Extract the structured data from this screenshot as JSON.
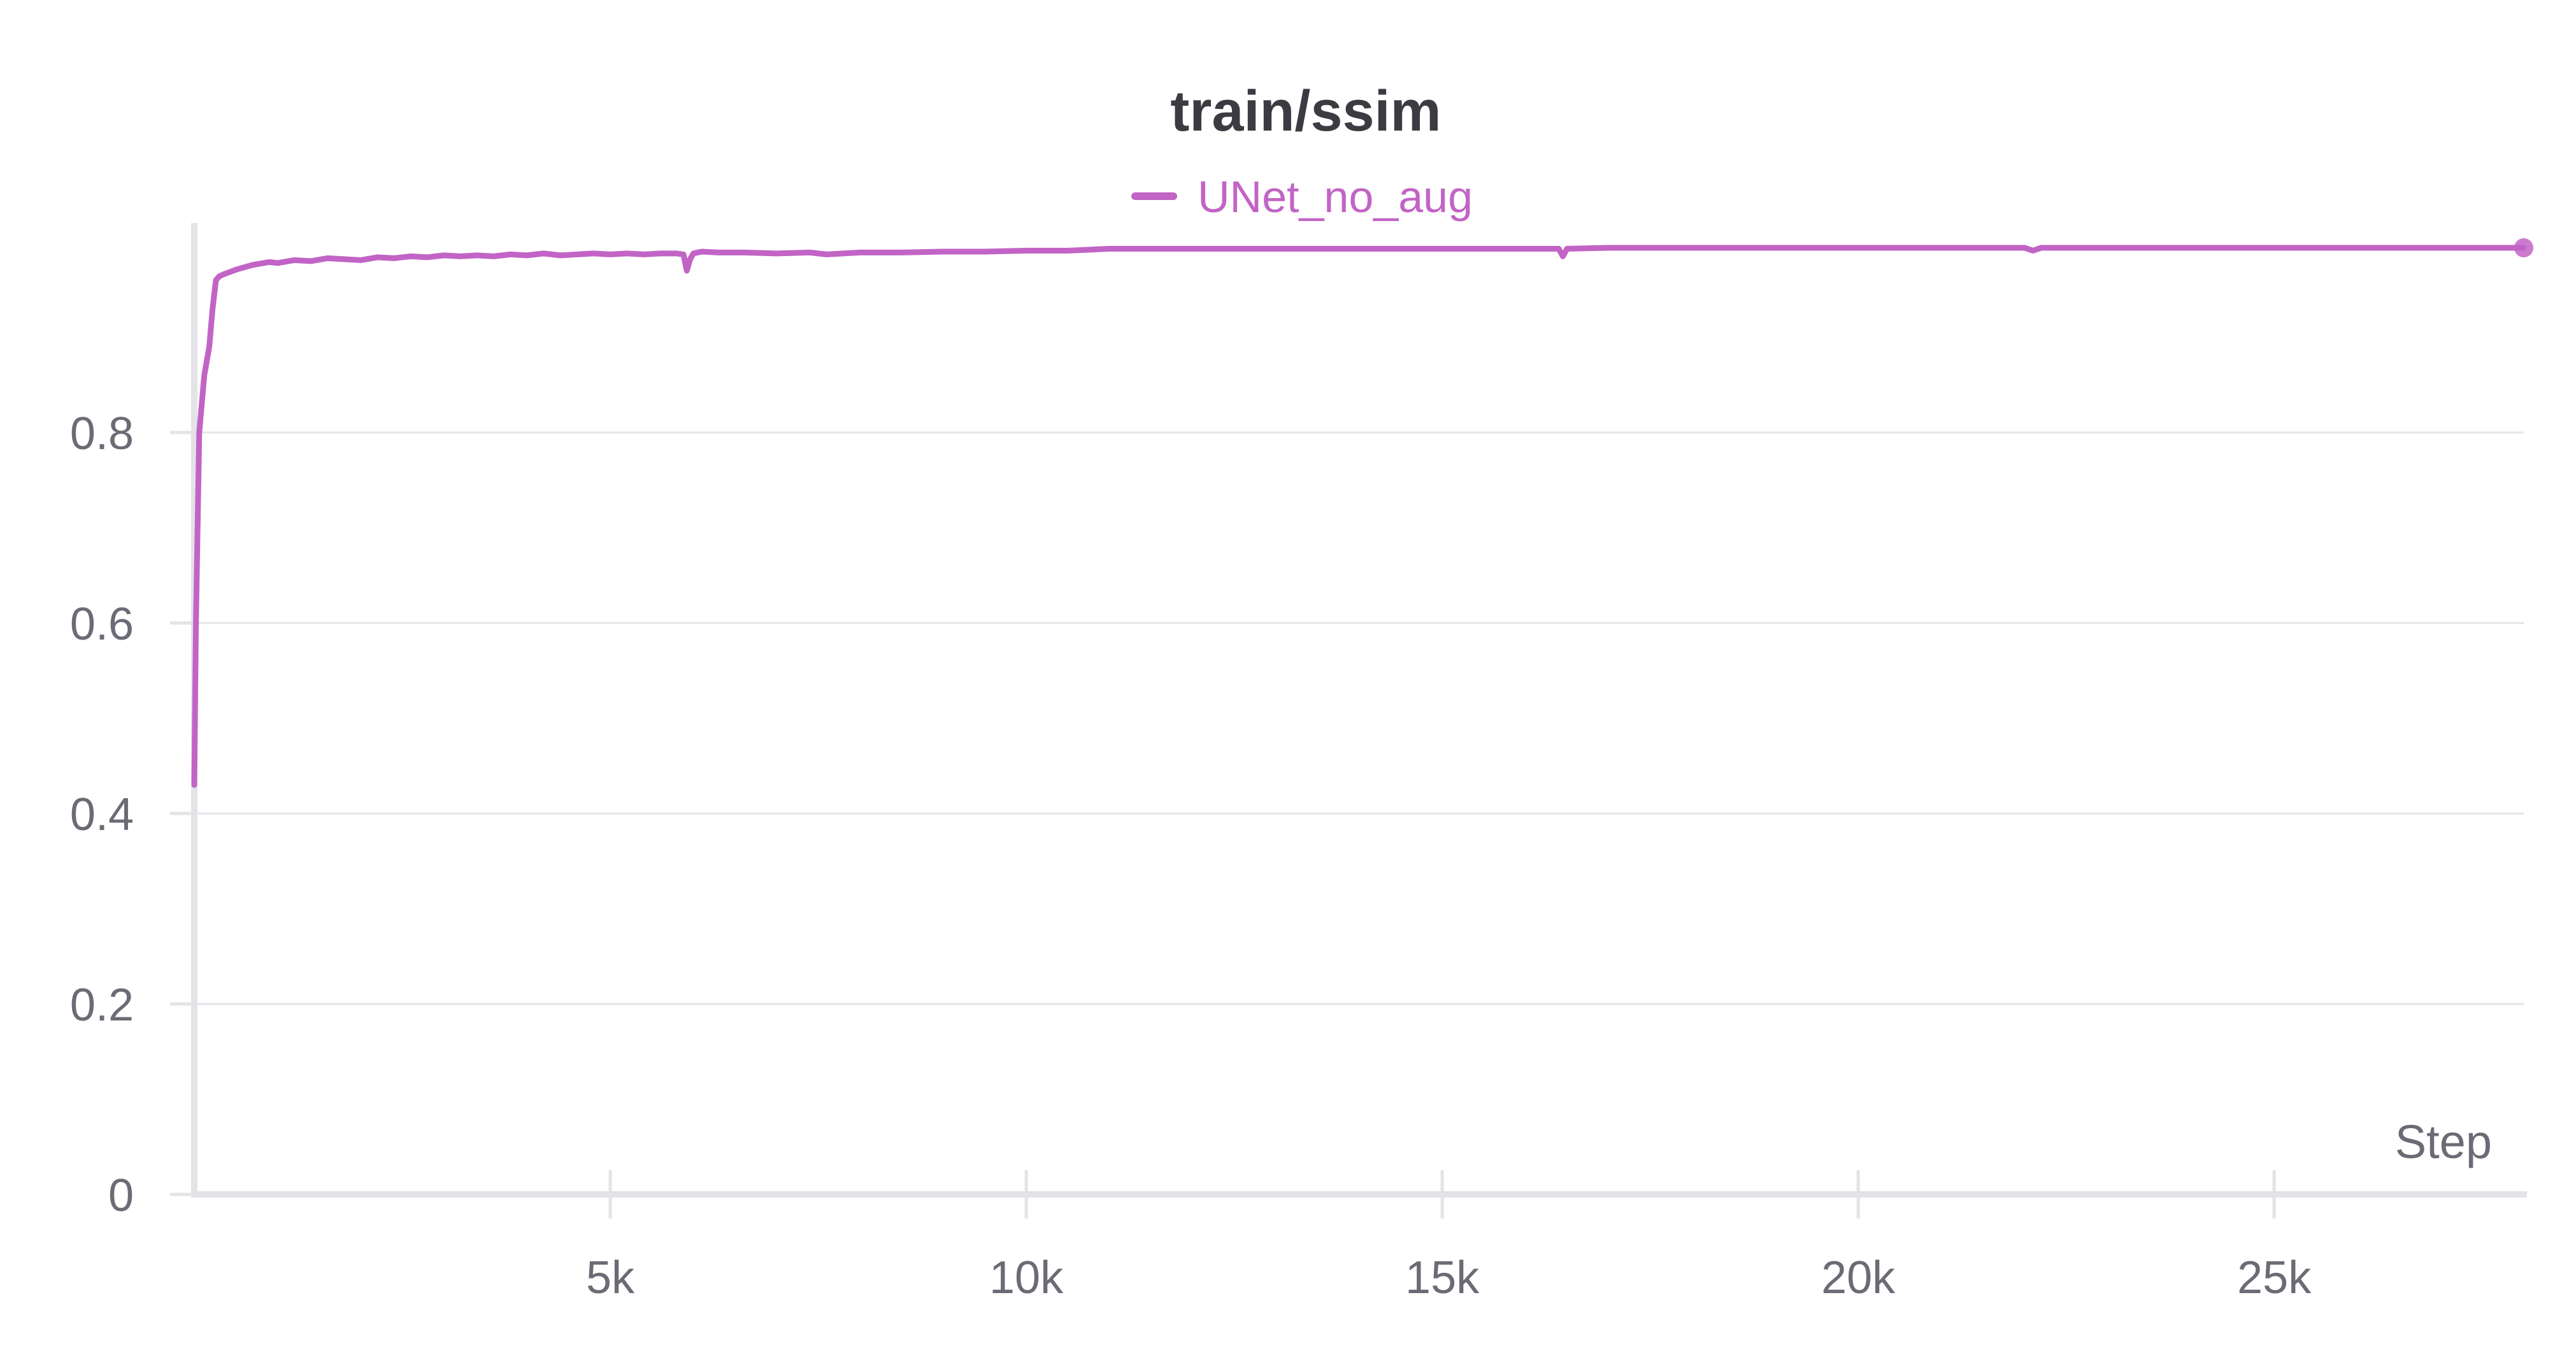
{
  "chart_data": {
    "type": "line",
    "title": "train/ssim",
    "xlabel": "Step",
    "ylabel": "",
    "xlim": [
      0,
      28000
    ],
    "ylim": [
      0,
      1
    ],
    "x_ticks": [
      5000,
      10000,
      15000,
      20000,
      25000
    ],
    "x_tick_labels": [
      "5k",
      "10k",
      "15k",
      "20k",
      "25k"
    ],
    "y_ticks": [
      0,
      0.2,
      0.4,
      0.6,
      0.8
    ],
    "y_tick_labels": [
      "0",
      "0.2",
      "0.4",
      "0.6",
      "0.8"
    ],
    "grid": true,
    "legend_position": "top-center",
    "series": [
      {
        "name": "UNet_no_aug",
        "color": "#c264c5",
        "x": [
          0,
          20,
          60,
          120,
          180,
          220,
          260,
          300,
          350,
          500,
          700,
          900,
          1000,
          1200,
          1400,
          1600,
          1800,
          2000,
          2200,
          2400,
          2600,
          2800,
          3000,
          3200,
          3400,
          3600,
          3800,
          4000,
          4200,
          4400,
          4600,
          4800,
          5000,
          5200,
          5400,
          5600,
          5800,
          5880,
          5920,
          5960,
          6000,
          6100,
          6300,
          6600,
          7000,
          7400,
          7600,
          7800,
          8000,
          8500,
          9000,
          9500,
          10000,
          10500,
          11000,
          12000,
          13000,
          14000,
          15000,
          16000,
          16400,
          16450,
          16500,
          17000,
          18000,
          19000,
          20000,
          21000,
          22000,
          22100,
          22200,
          23000,
          24000,
          25000,
          26000,
          27000,
          28000
        ],
        "y": [
          0.43,
          0.6,
          0.8,
          0.86,
          0.89,
          0.93,
          0.96,
          0.964,
          0.966,
          0.971,
          0.976,
          0.979,
          0.978,
          0.981,
          0.98,
          0.983,
          0.982,
          0.981,
          0.984,
          0.983,
          0.985,
          0.984,
          0.986,
          0.985,
          0.986,
          0.985,
          0.987,
          0.986,
          0.988,
          0.986,
          0.987,
          0.988,
          0.987,
          0.988,
          0.987,
          0.988,
          0.988,
          0.987,
          0.97,
          0.982,
          0.988,
          0.99,
          0.989,
          0.989,
          0.988,
          0.989,
          0.987,
          0.988,
          0.989,
          0.989,
          0.99,
          0.99,
          0.991,
          0.991,
          0.993,
          0.993,
          0.993,
          0.993,
          0.993,
          0.993,
          0.993,
          0.985,
          0.993,
          0.994,
          0.994,
          0.994,
          0.994,
          0.994,
          0.994,
          0.991,
          0.994,
          0.994,
          0.994,
          0.994,
          0.994,
          0.994,
          0.994
        ]
      }
    ]
  }
}
